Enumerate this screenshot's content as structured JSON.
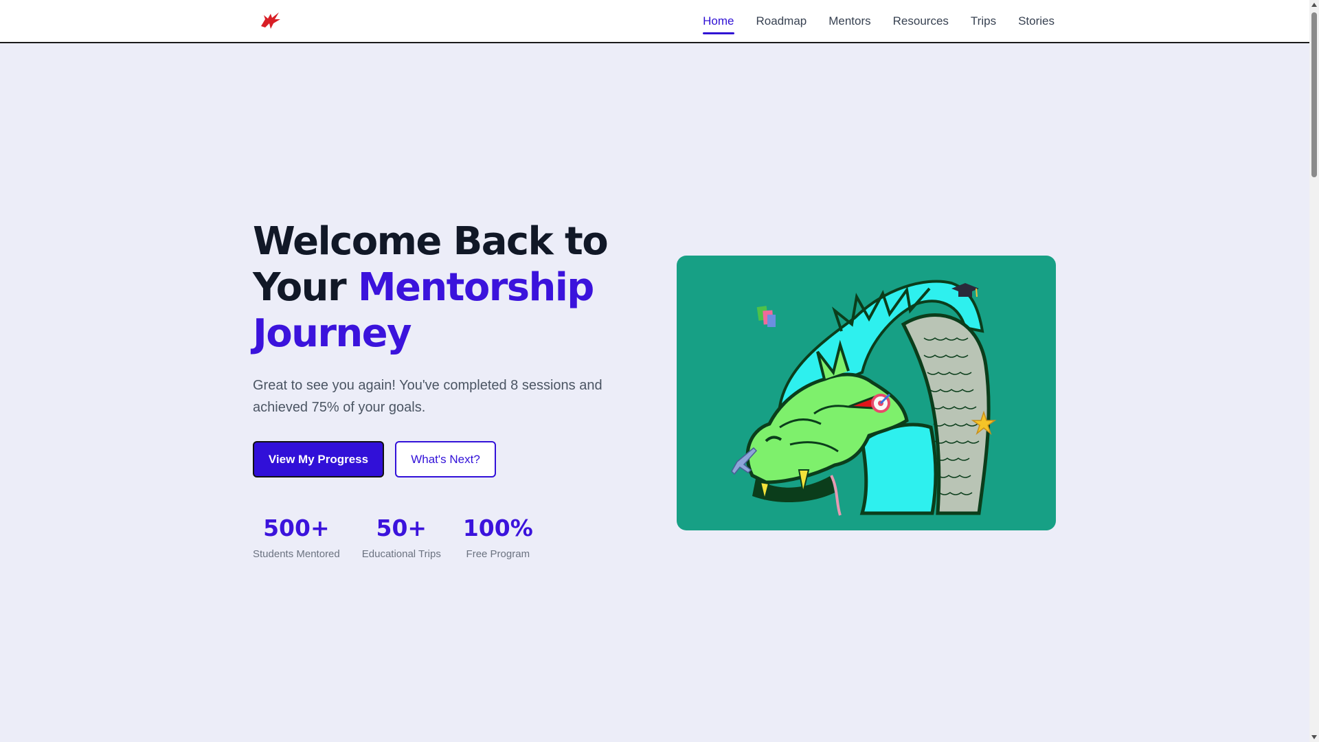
{
  "nav": {
    "logo_icon": "red-dragon-logo-icon",
    "items": [
      {
        "label": "Home",
        "active": true
      },
      {
        "label": "Roadmap",
        "active": false
      },
      {
        "label": "Mentors",
        "active": false
      },
      {
        "label": "Resources",
        "active": false
      },
      {
        "label": "Trips",
        "active": false
      },
      {
        "label": "Stories",
        "active": false
      }
    ]
  },
  "hero": {
    "headline_line1": "Welcome Back to",
    "headline_line2_prefix": "Your ",
    "headline_line2_accent": "Mentorship",
    "headline_line3_accent": "Journey",
    "subtitle": "Great to see you again! You've completed 8 sessions and achieved 75% of your goals.",
    "primary_button": "View My Progress",
    "secondary_button": "What's Next?",
    "image_icon": "green-dragon-illustration"
  },
  "stats": [
    {
      "value": "500+",
      "label": "Students Mentored"
    },
    {
      "value": "50+",
      "label": "Educational Trips"
    },
    {
      "value": "100%",
      "label": "Free Program"
    }
  ],
  "colors": {
    "accent": "#3b13dc",
    "button_primary": "#3110d8",
    "page_background": "#ecedf8",
    "image_background": "#17a085",
    "logo": "#d81f26"
  }
}
